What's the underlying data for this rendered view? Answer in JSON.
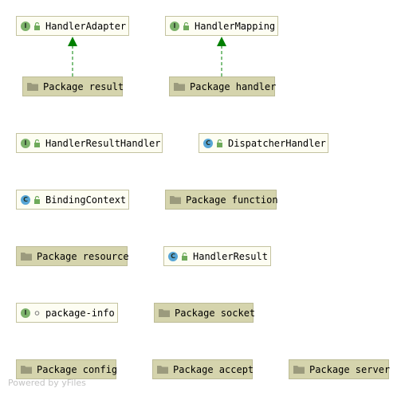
{
  "nodes": {
    "handler_adapter": {
      "label": "HandlerAdapter",
      "kind": "interface",
      "badge": "I"
    },
    "handler_mapping": {
      "label": "HandlerMapping",
      "kind": "interface",
      "badge": "I"
    },
    "pkg_result": {
      "label": "Package result",
      "kind": "package"
    },
    "pkg_handler": {
      "label": "Package handler",
      "kind": "package"
    },
    "handler_result_handler": {
      "label": "HandlerResultHandler",
      "kind": "interface",
      "badge": "I"
    },
    "dispatcher_handler": {
      "label": "DispatcherHandler",
      "kind": "class",
      "badge": "C"
    },
    "binding_context": {
      "label": "BindingContext",
      "kind": "class",
      "badge": "C"
    },
    "pkg_function": {
      "label": "Package function",
      "kind": "package"
    },
    "pkg_resource": {
      "label": "Package resource",
      "kind": "package"
    },
    "handler_result": {
      "label": "HandlerResult",
      "kind": "class",
      "badge": "C"
    },
    "package_info": {
      "label": "package-info",
      "kind": "interface",
      "badge": "I"
    },
    "pkg_socket": {
      "label": "Package socket",
      "kind": "package"
    },
    "pkg_config": {
      "label": "Package config",
      "kind": "package"
    },
    "pkg_accept": {
      "label": "Package accept",
      "kind": "package"
    },
    "pkg_server": {
      "label": "Package server",
      "kind": "package"
    }
  },
  "edges": [
    {
      "from": "Package result",
      "to": "HandlerAdapter",
      "style": "dashed-implements",
      "color": "#008000"
    },
    {
      "from": "Package handler",
      "to": "HandlerMapping",
      "style": "dashed-implements",
      "color": "#008000"
    }
  ],
  "colors": {
    "type_fill": "#fdfdf2",
    "package_fill": "#d5d4ad",
    "interface_badge": "#7cb26b",
    "class_badge": "#57a6d6",
    "edge": "#008000"
  },
  "icons": {
    "interface": "interface-badge-icon",
    "class": "class-badge-icon",
    "package": "folder-icon",
    "visibility": "lock-icon"
  },
  "watermark": "Powered by yFiles"
}
